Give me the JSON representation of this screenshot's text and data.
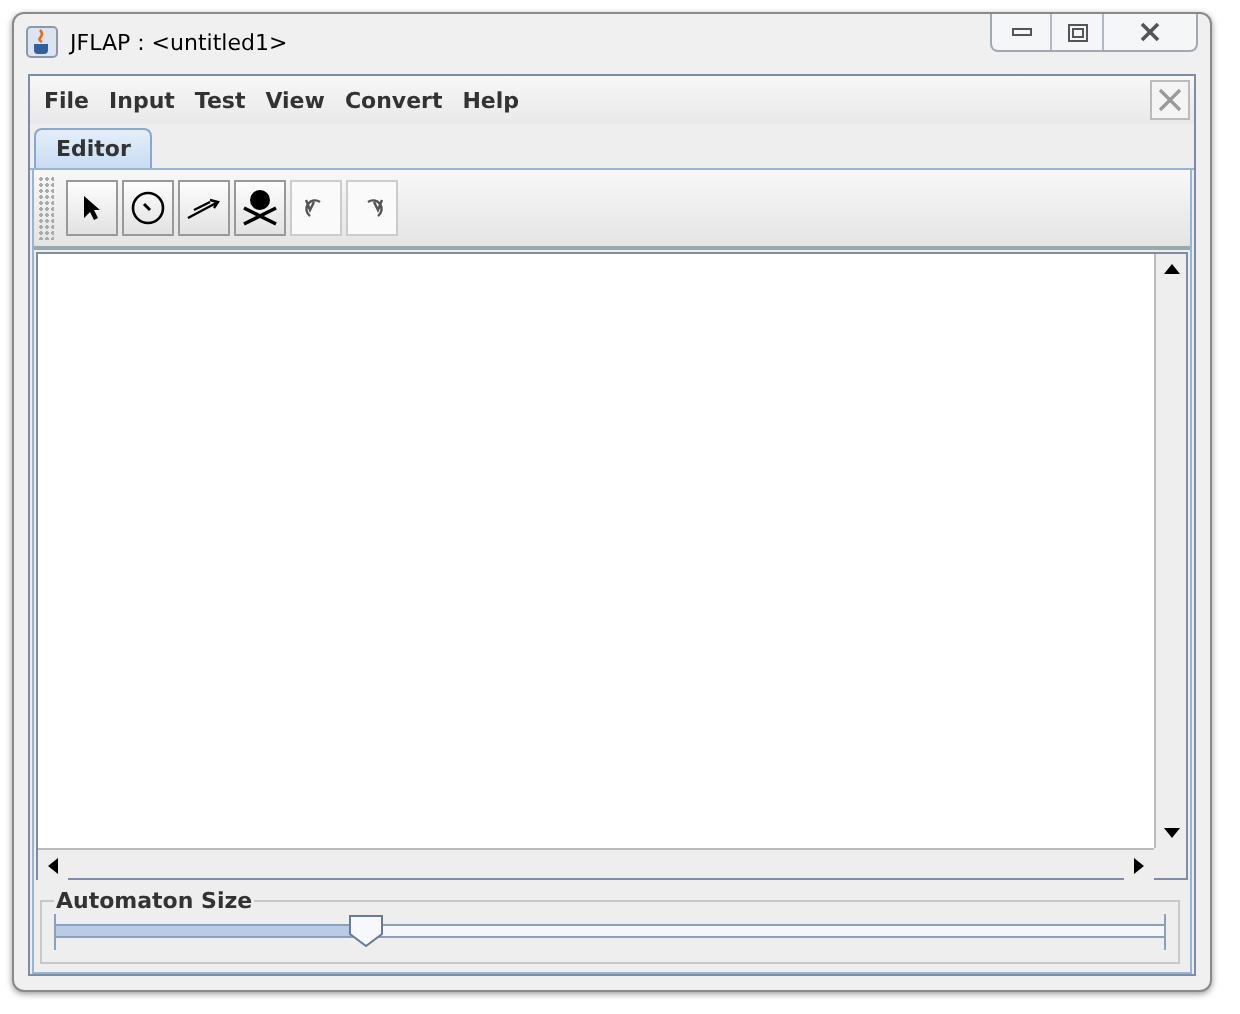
{
  "window": {
    "title": "JFLAP : <untitled1>"
  },
  "menu": [
    "File",
    "Input",
    "Test",
    "View",
    "Convert",
    "Help"
  ],
  "tabs": [
    {
      "label": "Editor",
      "selected": true
    }
  ],
  "toolbar": [
    {
      "kind": "arrow",
      "disabled": false
    },
    {
      "kind": "state",
      "disabled": false
    },
    {
      "kind": "transition",
      "disabled": false
    },
    {
      "kind": "delete",
      "disabled": false
    },
    {
      "kind": "undo",
      "disabled": true
    },
    {
      "kind": "redo",
      "disabled": true
    }
  ],
  "size_slider": {
    "label": "Automaton Size",
    "level": 0.28
  }
}
